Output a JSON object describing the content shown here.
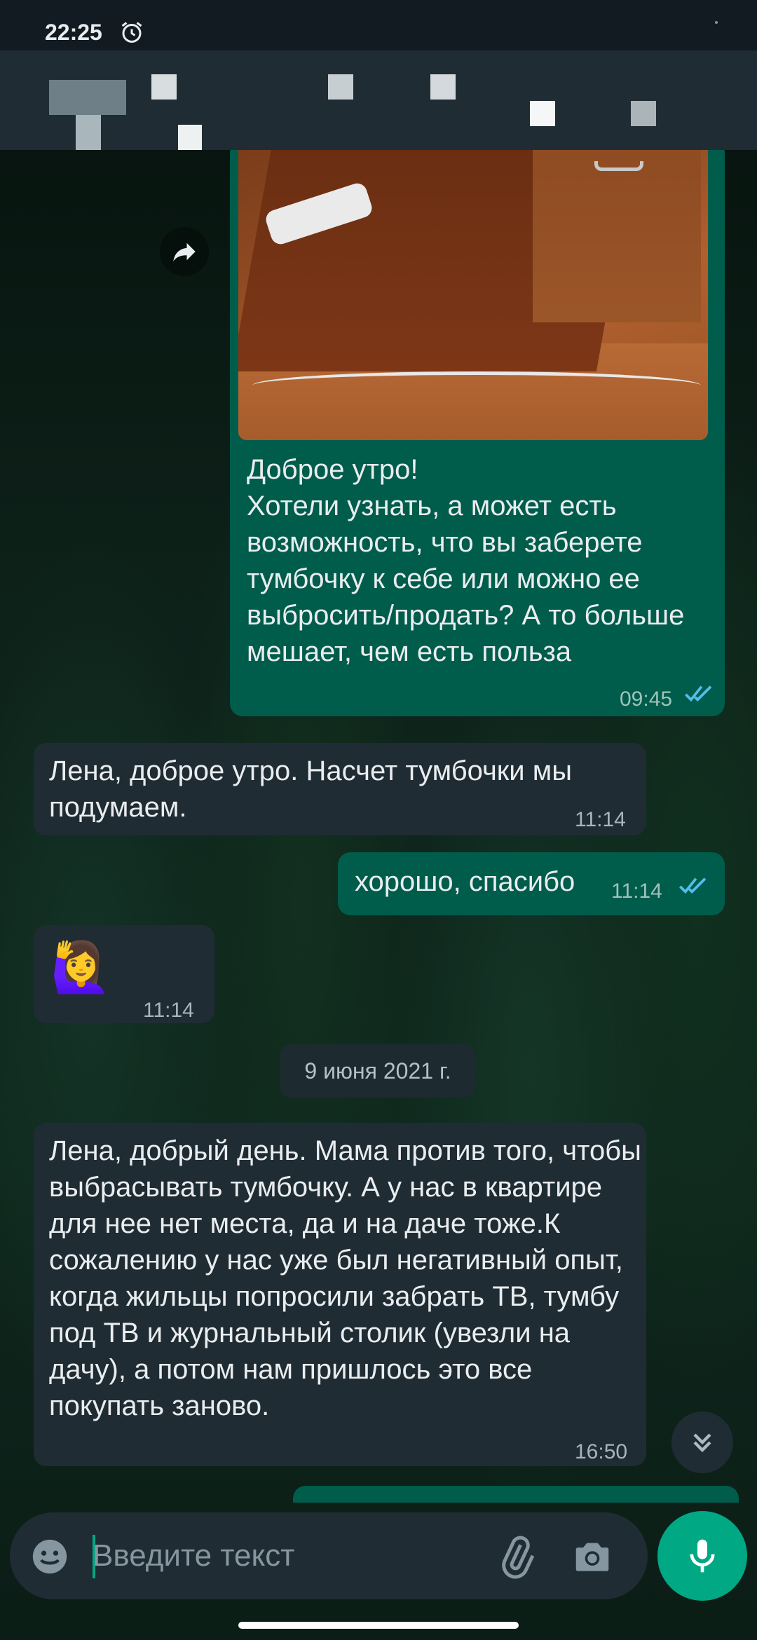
{
  "status_bar": {
    "time": "22:25",
    "alarm_icon": "alarm-clock-icon"
  },
  "chat": {
    "messages": [
      {
        "direction": "outgoing",
        "has_photo": true,
        "text": "Доброе утро!\nХотели узнать, а может есть возможность, что вы заберете тумбочку к себе или можно ее выбросить/продать? А то больше мешает, чем есть польза",
        "time": "09:45",
        "status": "read"
      },
      {
        "direction": "incoming",
        "text": "Лена, доброе утро. Насчет тумбочки мы подумаем.",
        "time": "11:14"
      },
      {
        "direction": "outgoing",
        "text": "хорошо, спасибо",
        "time": "11:14",
        "status": "read"
      },
      {
        "direction": "incoming",
        "text": "🙋‍♀️",
        "time": "11:14"
      },
      {
        "direction": "incoming",
        "text": "Лена, добрый день. Мама против того, чтобы выбрасывать тумбочку. А у нас в квартире для нее нет места, да и на даче тоже.К сожалению у нас уже был негативный опыт, когда жильцы попросили забрать ТВ, тумбу под ТВ и журнальный столик (увезли на дачу), а потом нам пришлось это все покупать заново.",
        "time": "16:50"
      }
    ],
    "date_separator": "9 июня 2021 г."
  },
  "composer": {
    "placeholder": "Введите текст",
    "value": "",
    "emoji_icon": "emoji-icon",
    "attach_icon": "paperclip-icon",
    "camera_icon": "camera-icon",
    "mic_icon": "microphone-icon"
  },
  "colors": {
    "outgoing_bubble": "#005c4b",
    "incoming_bubble": "#202c33",
    "accent": "#00a884",
    "read_ticks": "#53bdeb"
  }
}
